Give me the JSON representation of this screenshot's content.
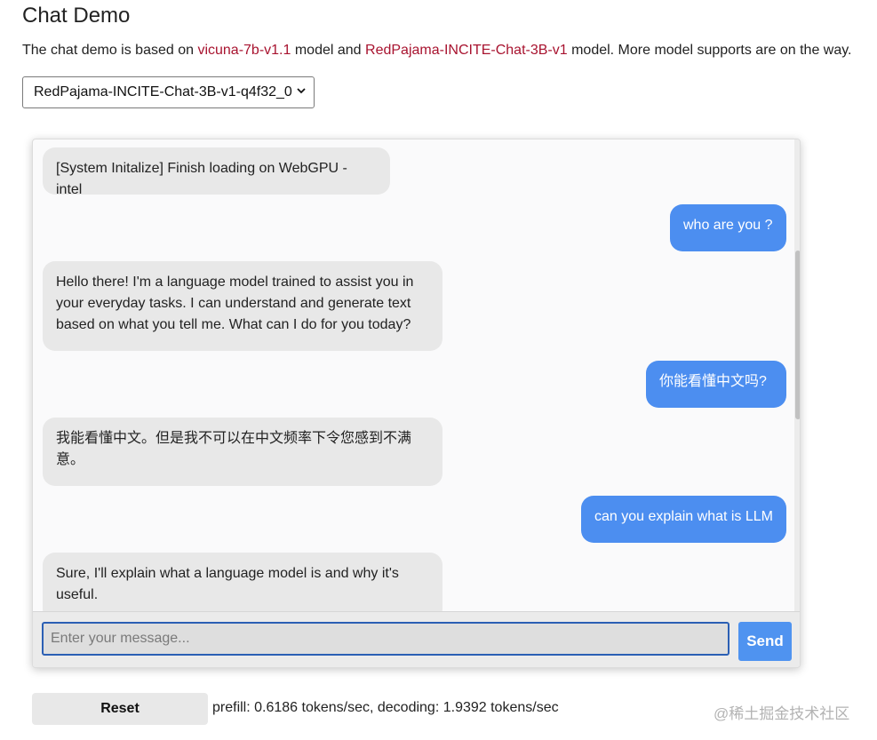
{
  "page": {
    "title": "Chat Demo",
    "intro": {
      "prefix": "The chat demo is based on ",
      "link1": "vicuna-7b-v1.1",
      "middle": " model and ",
      "link2": "RedPajama-INCITE-Chat-3B-v1",
      "suffix": " model. More model supports are on the way."
    }
  },
  "model_select": {
    "selected": "RedPajama-INCITE-Chat-3B-v1-q4f32_0"
  },
  "chat": {
    "messages": [
      {
        "role": "assistant",
        "text": "[System Initalize] Finish loading on WebGPU - intel"
      },
      {
        "role": "user",
        "text": "who are you ?"
      },
      {
        "role": "assistant",
        "lines": [
          "Hello there! I'm a language model trained to assist you in",
          "your everyday tasks. I can understand and generate text",
          "based on what you tell me. What can I do for you today?"
        ]
      },
      {
        "role": "user",
        "text": "你能看懂中文吗?"
      },
      {
        "role": "assistant",
        "lines": [
          "我能看懂中文。但是我不可以在中文频率下令您感到不满",
          "意。"
        ]
      },
      {
        "role": "user",
        "text": "can you explain what is LLM"
      },
      {
        "role": "assistant",
        "lines": [
          "Sure, I'll explain what a language model is and why it's",
          "useful."
        ]
      }
    ],
    "input_placeholder": "Enter your message...",
    "send_label": "Send"
  },
  "footer": {
    "reset_label": "Reset",
    "stats": "prefill: 0.6186 tokens/sec, decoding: 1.9392 tokens/sec"
  },
  "watermark": "@稀土掘金技术社区",
  "colors": {
    "link": "#a8132f",
    "user_bubble": "#4c8ef0",
    "assistant_bubble": "#e8e8e8",
    "send_button": "#4f93f0"
  }
}
